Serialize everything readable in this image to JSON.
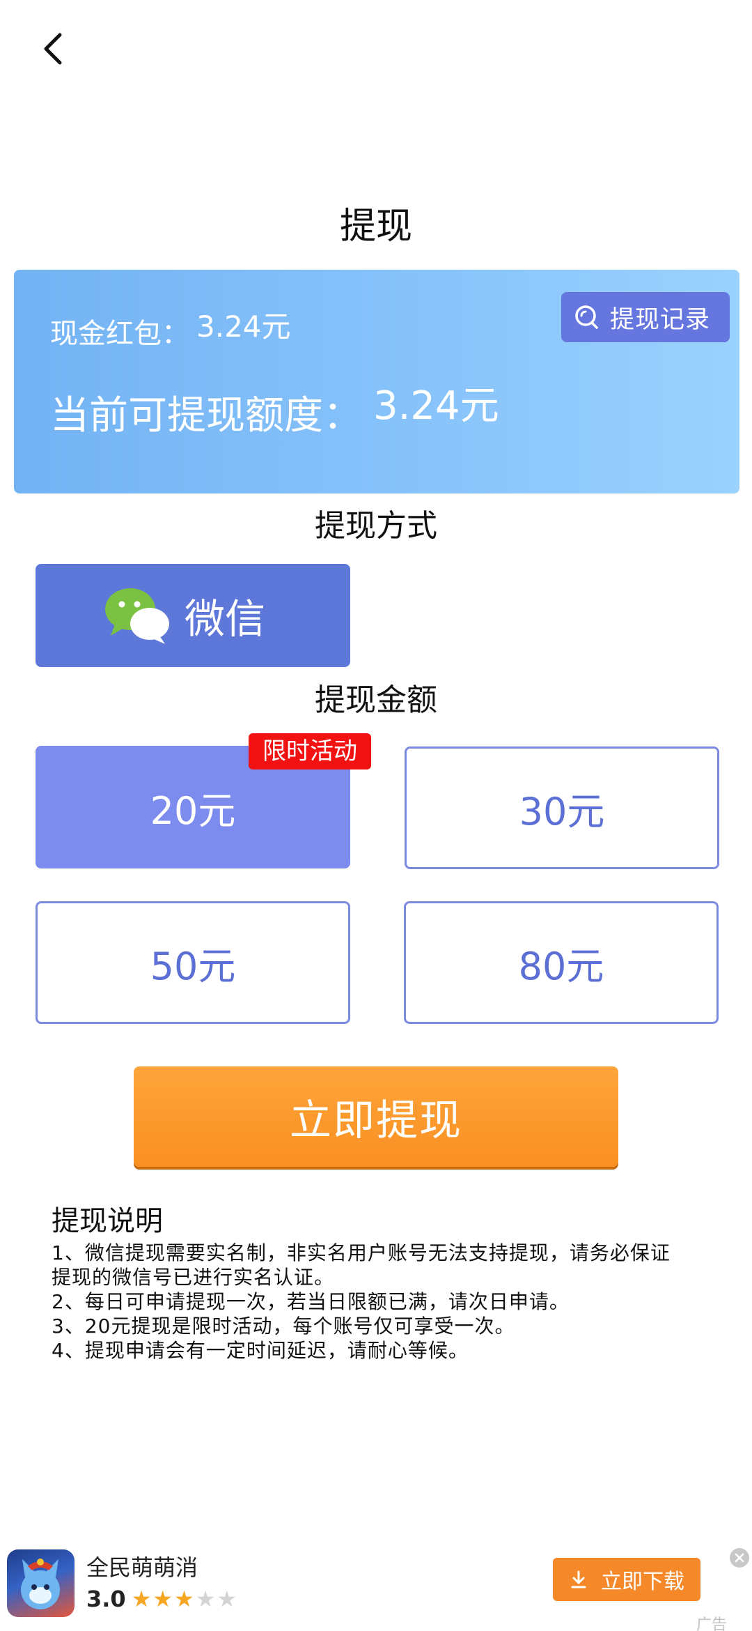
{
  "header": {
    "title": "提现"
  },
  "balance": {
    "cash_label": "现金红包：",
    "cash_value": "3.24元",
    "available_label": "当前可提现额度：",
    "available_value": "3.24元",
    "history_label": "提现记录"
  },
  "method": {
    "heading": "提现方式",
    "wechat_label": "微信"
  },
  "amount": {
    "heading": "提现金额",
    "promo_badge": "限时活动",
    "options": [
      {
        "label": "20元",
        "selected": true
      },
      {
        "label": "30元",
        "selected": false
      },
      {
        "label": "50元",
        "selected": false
      },
      {
        "label": "80元",
        "selected": false
      }
    ]
  },
  "submit_label": "立即提现",
  "notes": {
    "title": "提现说明",
    "lines": [
      "1、微信提现需要实名制，非实名用户账号无法支持提现，请务必保证",
      "提现的微信号已进行实名认证。",
      "2、每日可申请提现一次，若当日限额已满，请次日申请。",
      "3、20元提现是限时活动，每个账号仅可享受一次。",
      "4、提现申请会有一定时间延迟，请耐心等候。"
    ]
  },
  "ad": {
    "app_name": "全民萌萌消",
    "rating": "3.0",
    "stars_filled": 3,
    "stars_total": 5,
    "download_label": "立即下载",
    "tag": "广告"
  },
  "icons": {
    "back": "chevron-left-icon",
    "history": "search-icon",
    "wechat": "wechat-icon",
    "download": "download-icon",
    "close": "close-icon",
    "star": "star-icon"
  },
  "colors": {
    "primary": "#5d78d8",
    "selected_option": "#7c8bee",
    "badge_red": "#f31212",
    "orange": "#fb8f22",
    "card_gradient_start": "#73b3f4",
    "card_gradient_end": "#9ad2fd"
  }
}
